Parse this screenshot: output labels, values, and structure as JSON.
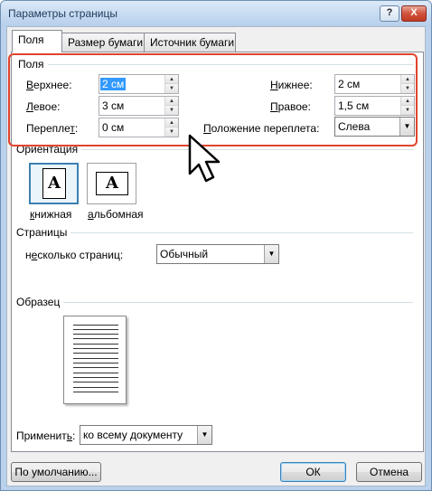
{
  "window": {
    "title": "Параметры страницы",
    "help_label": "?",
    "close_label": "X"
  },
  "tabs": [
    {
      "label": "Поля",
      "active": true
    },
    {
      "label": "Размер бумаги",
      "active": false
    },
    {
      "label": "Источник бумаги",
      "active": false
    }
  ],
  "margins": {
    "group_title": "Поля",
    "top": {
      "label": "Верхнее:",
      "value": "2 см"
    },
    "bottom": {
      "label": "Нижнее:",
      "value": "2 см"
    },
    "left": {
      "label": "Левое:",
      "value": "3 см"
    },
    "right": {
      "label": "Правое:",
      "value": "1,5 см"
    },
    "gutter": {
      "label": "Переплет:",
      "value": "0 см"
    },
    "gutter_position": {
      "label": "Положение переплета:",
      "value": "Слева"
    }
  },
  "orientation": {
    "group_title": "Ориентация",
    "portrait": {
      "label": "книжная",
      "glyph": "A"
    },
    "landscape": {
      "label": "альбомная",
      "glyph": "A"
    }
  },
  "pages": {
    "group_title": "Страницы",
    "multiple_label": "несколько страниц:",
    "multiple_value": "Обычный"
  },
  "preview": {
    "group_title": "Образец"
  },
  "apply": {
    "label": "Применить:",
    "value": "ко всему документу"
  },
  "buttons": {
    "default": "По умолчанию...",
    "ok": "ОК",
    "cancel": "Отмена"
  },
  "colors": {
    "highlight": "#e0442c",
    "selection": "#3399ff"
  }
}
